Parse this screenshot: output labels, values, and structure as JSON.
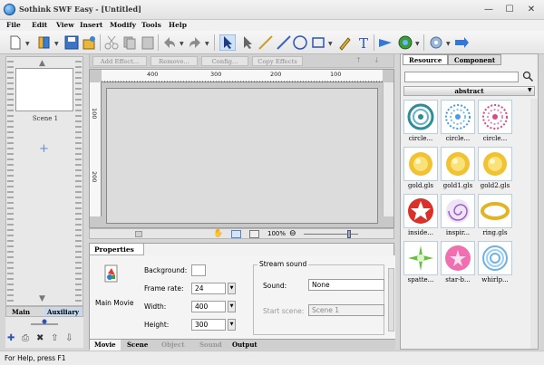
{
  "window": {
    "title": "Sothink SWF Easy - [Untitled]",
    "min": "—",
    "max": "☐",
    "close": "✕"
  },
  "menu": [
    "File",
    "Edit",
    "View",
    "Insert",
    "Modify",
    "Tools",
    "Help"
  ],
  "scene": {
    "label": "Scene 1"
  },
  "left_tabs": {
    "main": "Main",
    "auxiliary": "Auxiliary"
  },
  "action_bar": {
    "add_effect": "Add Effect...",
    "remove": "Remove...",
    "config": "Config...",
    "copy_effects": "Copy Effects"
  },
  "ruler": {
    "h": [
      "400",
      "300",
      "200",
      "100"
    ],
    "v": [
      "100",
      "200"
    ]
  },
  "zoom": {
    "level": "100%"
  },
  "properties": {
    "tab": "Properties",
    "item_label": "Main Movie",
    "background_label": "Background:",
    "frame_rate_label": "Frame rate:",
    "frame_rate": "24",
    "width_label": "Width:",
    "width": "400",
    "height_label": "Height:",
    "height": "300",
    "stream_title": "Stream sound",
    "sound_label": "Sound:",
    "sound_value": "None",
    "start_scene_label": "Start scene:",
    "start_scene_value": "Scene 1",
    "bottom_tabs": [
      "Movie",
      "Scene",
      "Object",
      "Sound",
      "Output"
    ]
  },
  "resource": {
    "tabs": {
      "resource": "Resource",
      "component": "Component"
    },
    "category": "abstract",
    "items": [
      {
        "label": "circle...",
        "kind": "teal-rings"
      },
      {
        "label": "circle...",
        "kind": "blue-dots"
      },
      {
        "label": "circle...",
        "kind": "pink-dots"
      },
      {
        "label": "gold.gls",
        "kind": "gold"
      },
      {
        "label": "gold1.gls",
        "kind": "gold"
      },
      {
        "label": "gold2.gls",
        "kind": "gold"
      },
      {
        "label": "inside...",
        "kind": "red-star"
      },
      {
        "label": "inspir...",
        "kind": "purple-swirl"
      },
      {
        "label": "ring.gls",
        "kind": "gold-ring"
      },
      {
        "label": "spatte...",
        "kind": "green-burst"
      },
      {
        "label": "star-b...",
        "kind": "pink-star"
      },
      {
        "label": "whirlp...",
        "kind": "blue-whirl"
      }
    ]
  },
  "status": {
    "text": "For Help, press F1"
  }
}
